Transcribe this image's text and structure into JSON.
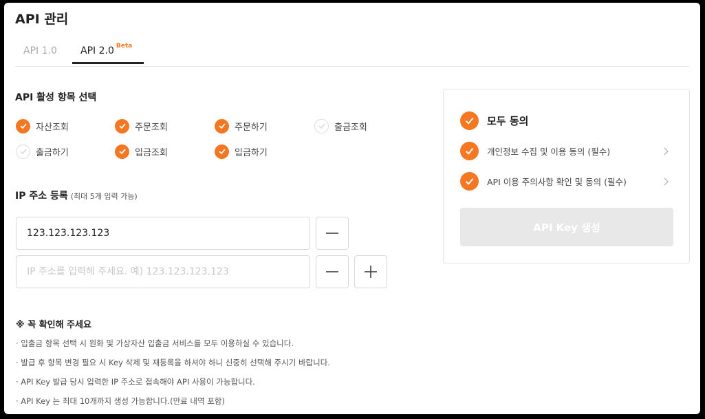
{
  "page_title": "API 관리",
  "tabs": [
    {
      "label": "API 1.0",
      "active": false
    },
    {
      "label": "API 2.0",
      "badge": "Beta",
      "active": true
    }
  ],
  "api_items": {
    "title": "API 활성 항목 선택",
    "items": [
      {
        "label": "자산조회",
        "checked": true
      },
      {
        "label": "주문조회",
        "checked": true
      },
      {
        "label": "주문하기",
        "checked": true
      },
      {
        "label": "출금조회",
        "checked": false
      },
      {
        "label": "출금하기",
        "checked": false
      },
      {
        "label": "입금조회",
        "checked": true
      },
      {
        "label": "입금하기",
        "checked": true
      }
    ]
  },
  "ip": {
    "title": "IP 주소 등록",
    "note": "(최대 5개 입력 가능)",
    "value": "123.123.123.123",
    "placeholder": "IP 주소를 입력해 주세요. 예) 123.123.123.123"
  },
  "notice": {
    "title": "※ 꼭 확인해 주세요",
    "lines": [
      "· 입출금 항목 선택 시 원화 및 가상자산 입출금 서비스를 모두 이용하실 수 있습니다.",
      "· 발급 후 항목 변경 필요 시 Key 삭제 및 재등록을 하셔야 하니 신중히 선택해 주시기 바랍니다.",
      "· API Key 발급 당시 입력한 IP 주소로 접속해야 API 사용이 가능합니다.",
      "· API Key 는 최대 10개까지 생성 가능합니다.(만료 내역 포함)"
    ]
  },
  "agreement": {
    "all_label": "모두 동의",
    "items": [
      {
        "label": "개인정보 수집 및 이용 동의 (필수)",
        "checked": true
      },
      {
        "label": "API 이용 주의사항 확인 및 동의 (필수)",
        "checked": true
      }
    ],
    "create_button": "API Key 생성"
  },
  "colors": {
    "accent": "#f57722",
    "disabled_button": "#e8e8e8"
  }
}
